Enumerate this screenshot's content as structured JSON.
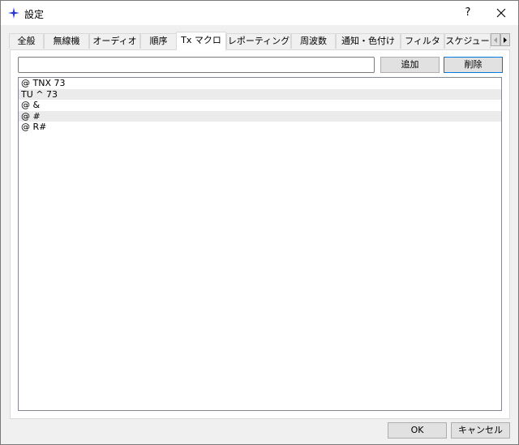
{
  "window": {
    "title": "設定",
    "help_label": "?",
    "icon": "sparkle-star-icon",
    "accent_color": "#2b39d8"
  },
  "tabs": [
    {
      "label": "全般"
    },
    {
      "label": "無線機"
    },
    {
      "label": "オーディオ"
    },
    {
      "label": "順序"
    },
    {
      "label": "Tx マクロ",
      "active": true
    },
    {
      "label": "レポーティング"
    },
    {
      "label": "周波数"
    },
    {
      "label": "通知・色付け"
    },
    {
      "label": "フィルタ"
    },
    {
      "label": "スケジュー"
    }
  ],
  "macro_panel": {
    "input_value": "",
    "add_label": "追加",
    "delete_label": "削除",
    "macros": [
      "@ TNX 73",
      "TU ^ 73",
      "@ &",
      "@ #",
      "@ R#"
    ]
  },
  "footer": {
    "ok_label": "OK",
    "cancel_label": "キャンセル"
  }
}
